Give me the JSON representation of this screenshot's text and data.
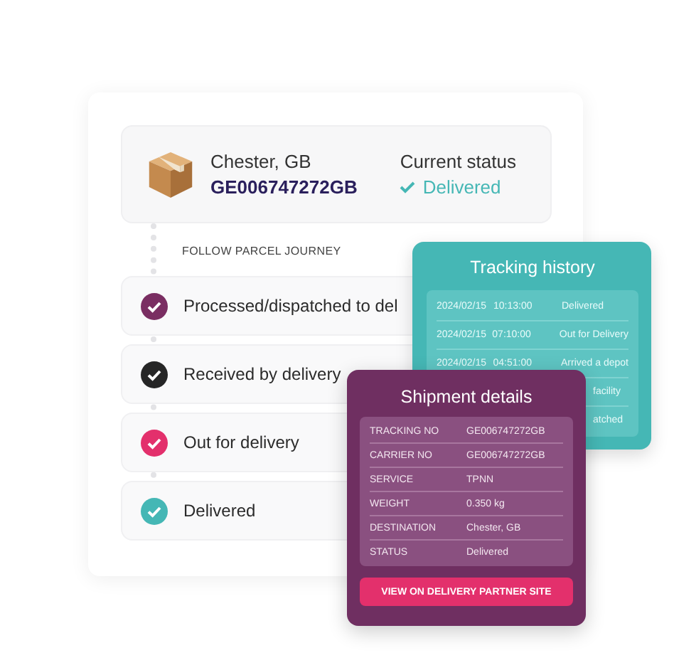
{
  "parcel": {
    "location": "Chester, GB",
    "tracking_number": "GE006747272GB",
    "status_label": "Current status",
    "status": "Delivered"
  },
  "journey": {
    "heading": "FOLLOW PARCEL JOURNEY",
    "steps": [
      {
        "label": "Processed/dispatched to del",
        "color": "#7a2e62"
      },
      {
        "label": "Received by delivery",
        "color": "#262626"
      },
      {
        "label": "Out for delivery",
        "color": "#e3306c"
      },
      {
        "label": "Delivered",
        "color": "#45b7b5"
      }
    ]
  },
  "tracking_history": {
    "title": "Tracking history",
    "rows": [
      {
        "date": "2024/02/15",
        "time": "10:13:00",
        "status": "Delivered"
      },
      {
        "date": "2024/02/15",
        "time": "07:10:00",
        "status": "Out for Delivery"
      },
      {
        "date": "2024/02/15",
        "time": "04:51:00",
        "status": "Arrived a depot"
      },
      {
        "status": "facility"
      },
      {
        "status": "atched"
      }
    ]
  },
  "shipment_details": {
    "title": "Shipment details",
    "rows": [
      {
        "label": "TRACKING NO",
        "value": "GE006747272GB"
      },
      {
        "label": "CARRIER NO",
        "value": "GE006747272GB"
      },
      {
        "label": "SERVICE",
        "value": "TPNN"
      },
      {
        "label": "WEIGHT",
        "value": "0.350 kg"
      },
      {
        "label": "DESTINATION",
        "value": "Chester, GB"
      },
      {
        "label": "STATUS",
        "value": "Delivered"
      }
    ],
    "button": "VIEW ON DELIVERY PARTNER SITE"
  }
}
